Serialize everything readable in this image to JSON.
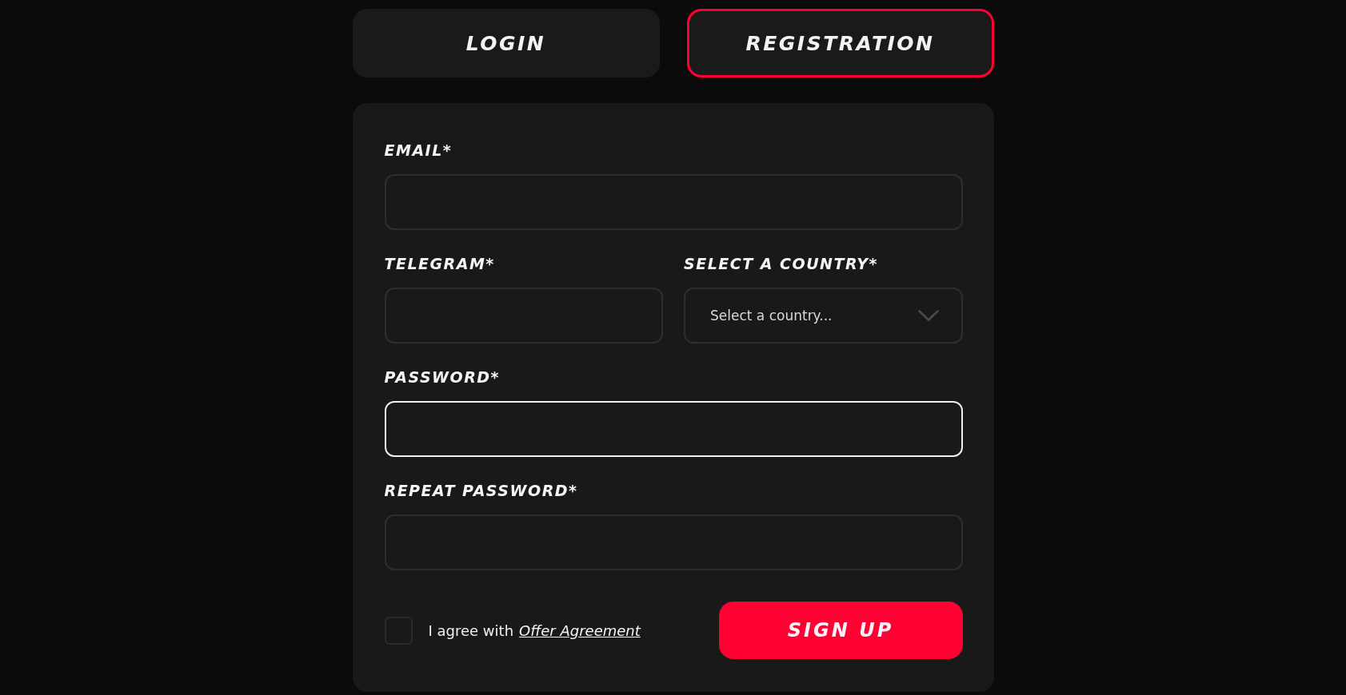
{
  "tabs": [
    {
      "label": "LOGIN",
      "selected": false
    },
    {
      "label": "REGISTRATION",
      "selected": true
    }
  ],
  "form": {
    "rows": [
      [
        {
          "kind": "text",
          "label": "EMAIL*",
          "focused": false
        }
      ],
      [
        {
          "kind": "text",
          "label": "TELEGRAM*",
          "focused": false
        },
        {
          "kind": "select",
          "label": "SELECT A COUNTRY*",
          "placeholder": "Select a country...",
          "focused": false
        }
      ],
      [
        {
          "kind": "password",
          "label": "PASSWORD*",
          "focused": true
        }
      ],
      [
        {
          "kind": "password",
          "label": "REPEAT PASSWORD*",
          "focused": false
        }
      ]
    ],
    "agreement": {
      "checked": false,
      "text": "I agree with",
      "link": "Offer Agreement"
    },
    "submit": "SIGN UP"
  }
}
